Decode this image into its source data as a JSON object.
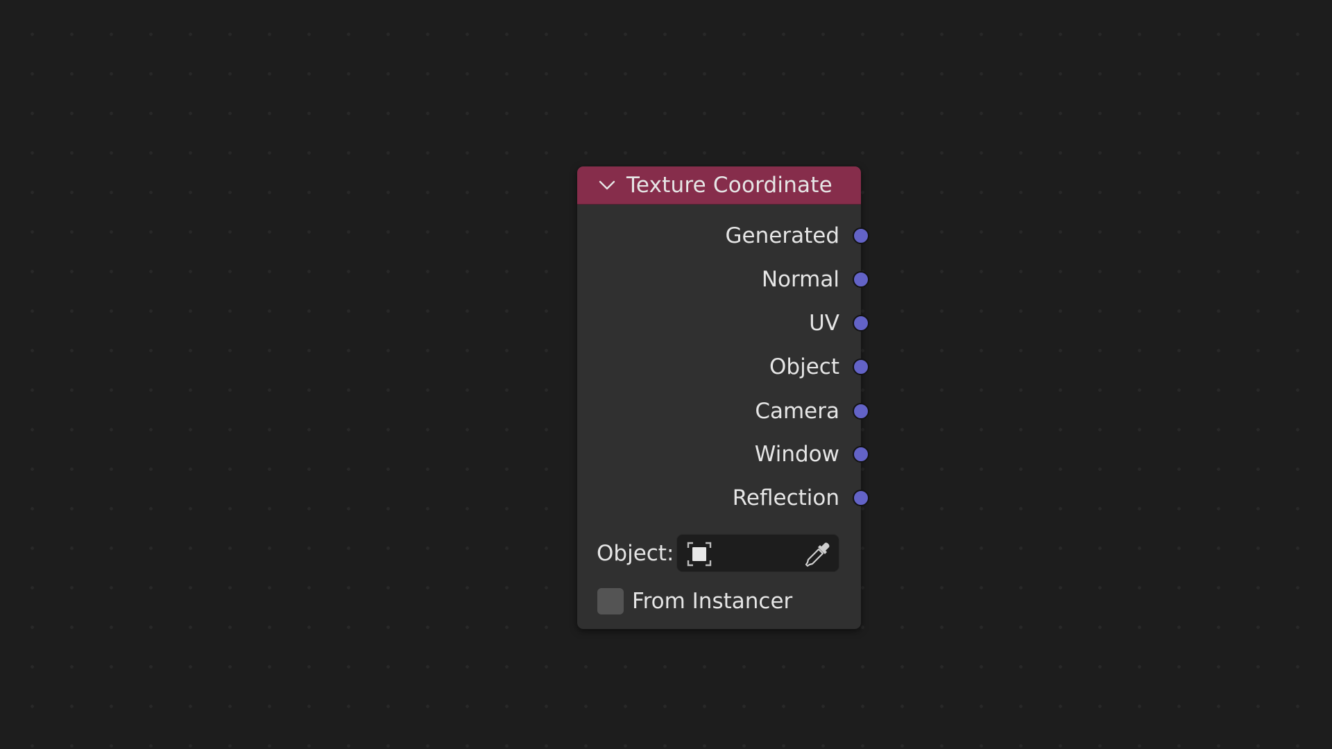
{
  "node": {
    "title": "Texture Coordinate",
    "header_color": "#862d4b",
    "collapse_icon": "chevron-down-icon",
    "outputs": [
      {
        "label": "Generated",
        "socket_color": "#6363c7"
      },
      {
        "label": "Normal",
        "socket_color": "#6363c7"
      },
      {
        "label": "UV",
        "socket_color": "#6363c7"
      },
      {
        "label": "Object",
        "socket_color": "#6363c7"
      },
      {
        "label": "Camera",
        "socket_color": "#6363c7"
      },
      {
        "label": "Window",
        "socket_color": "#6363c7"
      },
      {
        "label": "Reflection",
        "socket_color": "#6363c7"
      }
    ],
    "object_field": {
      "label": "Object:",
      "value": "",
      "icon": "object-data-icon",
      "picker_icon": "eyedropper-icon"
    },
    "from_instancer": {
      "label": "From Instancer",
      "checked": false
    }
  }
}
